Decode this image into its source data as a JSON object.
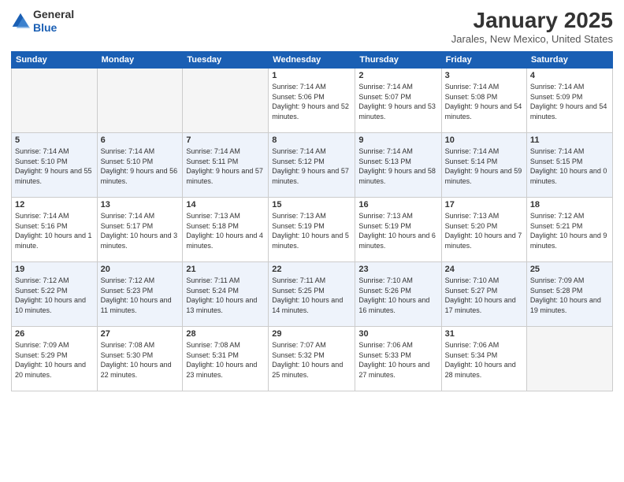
{
  "logo": {
    "line1": "General",
    "line2": "Blue"
  },
  "title": "January 2025",
  "location": "Jarales, New Mexico, United States",
  "days_of_week": [
    "Sunday",
    "Monday",
    "Tuesday",
    "Wednesday",
    "Thursday",
    "Friday",
    "Saturday"
  ],
  "weeks": [
    [
      {
        "day": "",
        "info": ""
      },
      {
        "day": "",
        "info": ""
      },
      {
        "day": "",
        "info": ""
      },
      {
        "day": "1",
        "info": "Sunrise: 7:14 AM\nSunset: 5:06 PM\nDaylight: 9 hours and 52 minutes."
      },
      {
        "day": "2",
        "info": "Sunrise: 7:14 AM\nSunset: 5:07 PM\nDaylight: 9 hours and 53 minutes."
      },
      {
        "day": "3",
        "info": "Sunrise: 7:14 AM\nSunset: 5:08 PM\nDaylight: 9 hours and 54 minutes."
      },
      {
        "day": "4",
        "info": "Sunrise: 7:14 AM\nSunset: 5:09 PM\nDaylight: 9 hours and 54 minutes."
      }
    ],
    [
      {
        "day": "5",
        "info": "Sunrise: 7:14 AM\nSunset: 5:10 PM\nDaylight: 9 hours and 55 minutes."
      },
      {
        "day": "6",
        "info": "Sunrise: 7:14 AM\nSunset: 5:10 PM\nDaylight: 9 hours and 56 minutes."
      },
      {
        "day": "7",
        "info": "Sunrise: 7:14 AM\nSunset: 5:11 PM\nDaylight: 9 hours and 57 minutes."
      },
      {
        "day": "8",
        "info": "Sunrise: 7:14 AM\nSunset: 5:12 PM\nDaylight: 9 hours and 57 minutes."
      },
      {
        "day": "9",
        "info": "Sunrise: 7:14 AM\nSunset: 5:13 PM\nDaylight: 9 hours and 58 minutes."
      },
      {
        "day": "10",
        "info": "Sunrise: 7:14 AM\nSunset: 5:14 PM\nDaylight: 9 hours and 59 minutes."
      },
      {
        "day": "11",
        "info": "Sunrise: 7:14 AM\nSunset: 5:15 PM\nDaylight: 10 hours and 0 minutes."
      }
    ],
    [
      {
        "day": "12",
        "info": "Sunrise: 7:14 AM\nSunset: 5:16 PM\nDaylight: 10 hours and 1 minute."
      },
      {
        "day": "13",
        "info": "Sunrise: 7:14 AM\nSunset: 5:17 PM\nDaylight: 10 hours and 3 minutes."
      },
      {
        "day": "14",
        "info": "Sunrise: 7:13 AM\nSunset: 5:18 PM\nDaylight: 10 hours and 4 minutes."
      },
      {
        "day": "15",
        "info": "Sunrise: 7:13 AM\nSunset: 5:19 PM\nDaylight: 10 hours and 5 minutes."
      },
      {
        "day": "16",
        "info": "Sunrise: 7:13 AM\nSunset: 5:19 PM\nDaylight: 10 hours and 6 minutes."
      },
      {
        "day": "17",
        "info": "Sunrise: 7:13 AM\nSunset: 5:20 PM\nDaylight: 10 hours and 7 minutes."
      },
      {
        "day": "18",
        "info": "Sunrise: 7:12 AM\nSunset: 5:21 PM\nDaylight: 10 hours and 9 minutes."
      }
    ],
    [
      {
        "day": "19",
        "info": "Sunrise: 7:12 AM\nSunset: 5:22 PM\nDaylight: 10 hours and 10 minutes."
      },
      {
        "day": "20",
        "info": "Sunrise: 7:12 AM\nSunset: 5:23 PM\nDaylight: 10 hours and 11 minutes."
      },
      {
        "day": "21",
        "info": "Sunrise: 7:11 AM\nSunset: 5:24 PM\nDaylight: 10 hours and 13 minutes."
      },
      {
        "day": "22",
        "info": "Sunrise: 7:11 AM\nSunset: 5:25 PM\nDaylight: 10 hours and 14 minutes."
      },
      {
        "day": "23",
        "info": "Sunrise: 7:10 AM\nSunset: 5:26 PM\nDaylight: 10 hours and 16 minutes."
      },
      {
        "day": "24",
        "info": "Sunrise: 7:10 AM\nSunset: 5:27 PM\nDaylight: 10 hours and 17 minutes."
      },
      {
        "day": "25",
        "info": "Sunrise: 7:09 AM\nSunset: 5:28 PM\nDaylight: 10 hours and 19 minutes."
      }
    ],
    [
      {
        "day": "26",
        "info": "Sunrise: 7:09 AM\nSunset: 5:29 PM\nDaylight: 10 hours and 20 minutes."
      },
      {
        "day": "27",
        "info": "Sunrise: 7:08 AM\nSunset: 5:30 PM\nDaylight: 10 hours and 22 minutes."
      },
      {
        "day": "28",
        "info": "Sunrise: 7:08 AM\nSunset: 5:31 PM\nDaylight: 10 hours and 23 minutes."
      },
      {
        "day": "29",
        "info": "Sunrise: 7:07 AM\nSunset: 5:32 PM\nDaylight: 10 hours and 25 minutes."
      },
      {
        "day": "30",
        "info": "Sunrise: 7:06 AM\nSunset: 5:33 PM\nDaylight: 10 hours and 27 minutes."
      },
      {
        "day": "31",
        "info": "Sunrise: 7:06 AM\nSunset: 5:34 PM\nDaylight: 10 hours and 28 minutes."
      },
      {
        "day": "",
        "info": ""
      }
    ]
  ]
}
